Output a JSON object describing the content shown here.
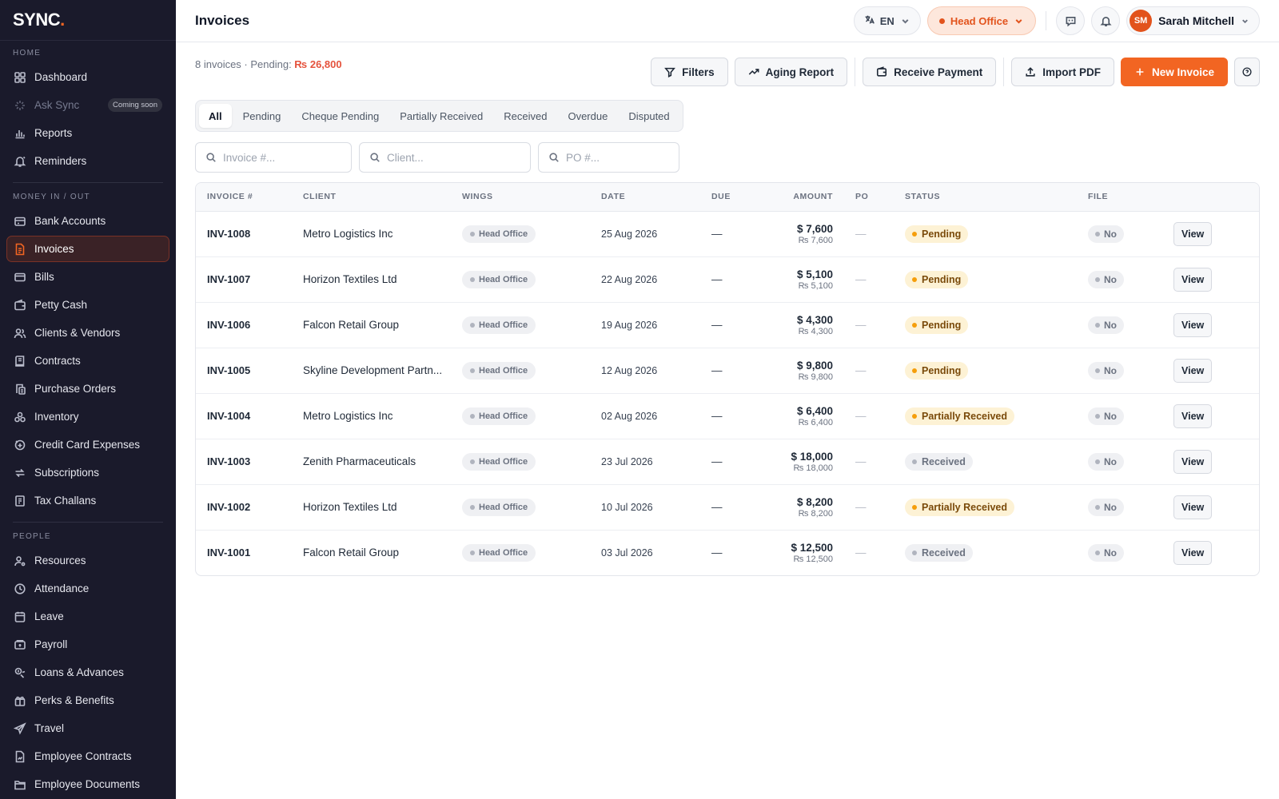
{
  "brand": {
    "name": "SYNC",
    "dot": "."
  },
  "sidebar": {
    "sections": [
      {
        "label": "HOME",
        "items": [
          {
            "label": "Dashboard",
            "icon": "dashboard-icon"
          },
          {
            "label": "Ask Sync",
            "icon": "sparkle-icon",
            "badge": "Coming soon",
            "disabled": true
          },
          {
            "label": "Reports",
            "icon": "bar-chart-icon"
          },
          {
            "label": "Reminders",
            "icon": "bell-icon"
          }
        ]
      },
      {
        "label": "MONEY IN / OUT",
        "items": [
          {
            "label": "Bank Accounts",
            "icon": "bank-icon"
          },
          {
            "label": "Invoices",
            "icon": "invoice-icon",
            "active": true
          },
          {
            "label": "Bills",
            "icon": "bill-icon"
          },
          {
            "label": "Petty Cash",
            "icon": "wallet-icon"
          },
          {
            "label": "Clients & Vendors",
            "icon": "users-icon"
          },
          {
            "label": "Contracts",
            "icon": "contract-icon"
          },
          {
            "label": "Purchase Orders",
            "icon": "purchase-order-icon"
          },
          {
            "label": "Inventory",
            "icon": "inventory-icon"
          },
          {
            "label": "Credit Card Expenses",
            "icon": "credit-card-icon"
          },
          {
            "label": "Subscriptions",
            "icon": "refresh-icon"
          },
          {
            "label": "Tax Challans",
            "icon": "tax-icon"
          }
        ]
      },
      {
        "label": "PEOPLE",
        "items": [
          {
            "label": "Resources",
            "icon": "user-gear-icon"
          },
          {
            "label": "Attendance",
            "icon": "clock-icon"
          },
          {
            "label": "Leave",
            "icon": "calendar-icon"
          },
          {
            "label": "Payroll",
            "icon": "payroll-icon"
          },
          {
            "label": "Loans & Advances",
            "icon": "loan-icon"
          },
          {
            "label": "Perks & Benefits",
            "icon": "gift-icon"
          },
          {
            "label": "Travel",
            "icon": "plane-icon"
          },
          {
            "label": "Employee Contracts",
            "icon": "emp-contract-icon"
          },
          {
            "label": "Employee Documents",
            "icon": "folder-icon"
          }
        ]
      }
    ]
  },
  "header": {
    "title": "Invoices",
    "language": "EN",
    "branch": "Head Office",
    "user": {
      "initials": "SM",
      "name": "Sarah Mitchell"
    }
  },
  "summary": {
    "prefix": "8 invoices · Pending: ",
    "pending_amount": "₨ 26,800"
  },
  "actions": {
    "filters": "Filters",
    "aging_report": "Aging Report",
    "receive_payment": "Receive Payment",
    "import_pdf": "Import PDF",
    "new_invoice": "New Invoice"
  },
  "tabs": [
    {
      "label": "All",
      "active": true
    },
    {
      "label": "Pending"
    },
    {
      "label": "Cheque Pending"
    },
    {
      "label": "Partially Received"
    },
    {
      "label": "Received"
    },
    {
      "label": "Overdue"
    },
    {
      "label": "Disputed"
    }
  ],
  "search": {
    "invoice_placeholder": "Invoice #...",
    "client_placeholder": "Client...",
    "po_placeholder": "PO #..."
  },
  "table": {
    "columns": [
      "INVOICE #",
      "CLIENT",
      "WINGS",
      "DATE",
      "DUE",
      "AMOUNT",
      "PO",
      "STATUS",
      "FILE",
      ""
    ],
    "rows": [
      {
        "invoice": "INV-1008",
        "client": "Metro Logistics Inc",
        "wing": "Head Office",
        "date": "25 Aug 2026",
        "due": "—",
        "amount": "$ 7,600",
        "amount_pkr": "₨ 7,600",
        "po": "—",
        "status": "Pending",
        "status_kind": "pending",
        "file": "No",
        "action": "View"
      },
      {
        "invoice": "INV-1007",
        "client": "Horizon Textiles Ltd",
        "wing": "Head Office",
        "date": "22 Aug 2026",
        "due": "—",
        "amount": "$ 5,100",
        "amount_pkr": "₨ 5,100",
        "po": "—",
        "status": "Pending",
        "status_kind": "pending",
        "file": "No",
        "action": "View"
      },
      {
        "invoice": "INV-1006",
        "client": "Falcon Retail Group",
        "wing": "Head Office",
        "date": "19 Aug 2026",
        "due": "—",
        "amount": "$ 4,300",
        "amount_pkr": "₨ 4,300",
        "po": "—",
        "status": "Pending",
        "status_kind": "pending",
        "file": "No",
        "action": "View"
      },
      {
        "invoice": "INV-1005",
        "client": "Skyline Development Partn...",
        "wing": "Head Office",
        "date": "12 Aug 2026",
        "due": "—",
        "amount": "$ 9,800",
        "amount_pkr": "₨ 9,800",
        "po": "—",
        "status": "Pending",
        "status_kind": "pending",
        "file": "No",
        "action": "View"
      },
      {
        "invoice": "INV-1004",
        "client": "Metro Logistics Inc",
        "wing": "Head Office",
        "date": "02 Aug 2026",
        "due": "—",
        "amount": "$ 6,400",
        "amount_pkr": "₨ 6,400",
        "po": "—",
        "status": "Partially Received",
        "status_kind": "pending",
        "file": "No",
        "action": "View"
      },
      {
        "invoice": "INV-1003",
        "client": "Zenith Pharmaceuticals",
        "wing": "Head Office",
        "date": "23 Jul 2026",
        "due": "—",
        "amount": "$ 18,000",
        "amount_pkr": "₨ 18,000",
        "po": "—",
        "status": "Received",
        "status_kind": "received",
        "file": "No",
        "action": "View"
      },
      {
        "invoice": "INV-1002",
        "client": "Horizon Textiles Ltd",
        "wing": "Head Office",
        "date": "10 Jul 2026",
        "due": "—",
        "amount": "$ 8,200",
        "amount_pkr": "₨ 8,200",
        "po": "—",
        "status": "Partially Received",
        "status_kind": "pending",
        "file": "No",
        "action": "View"
      },
      {
        "invoice": "INV-1001",
        "client": "Falcon Retail Group",
        "wing": "Head Office",
        "date": "03 Jul 2026",
        "due": "—",
        "amount": "$ 12,500",
        "amount_pkr": "₨ 12,500",
        "po": "—",
        "status": "Received",
        "status_kind": "received",
        "file": "No",
        "action": "View"
      }
    ]
  },
  "colors": {
    "accent": "#f26522",
    "sidebar_bg": "#1a1a2b",
    "pending_amount": "#e5533d",
    "pending_badge": "#fdf2d5",
    "received_badge": "#eff0f3"
  }
}
